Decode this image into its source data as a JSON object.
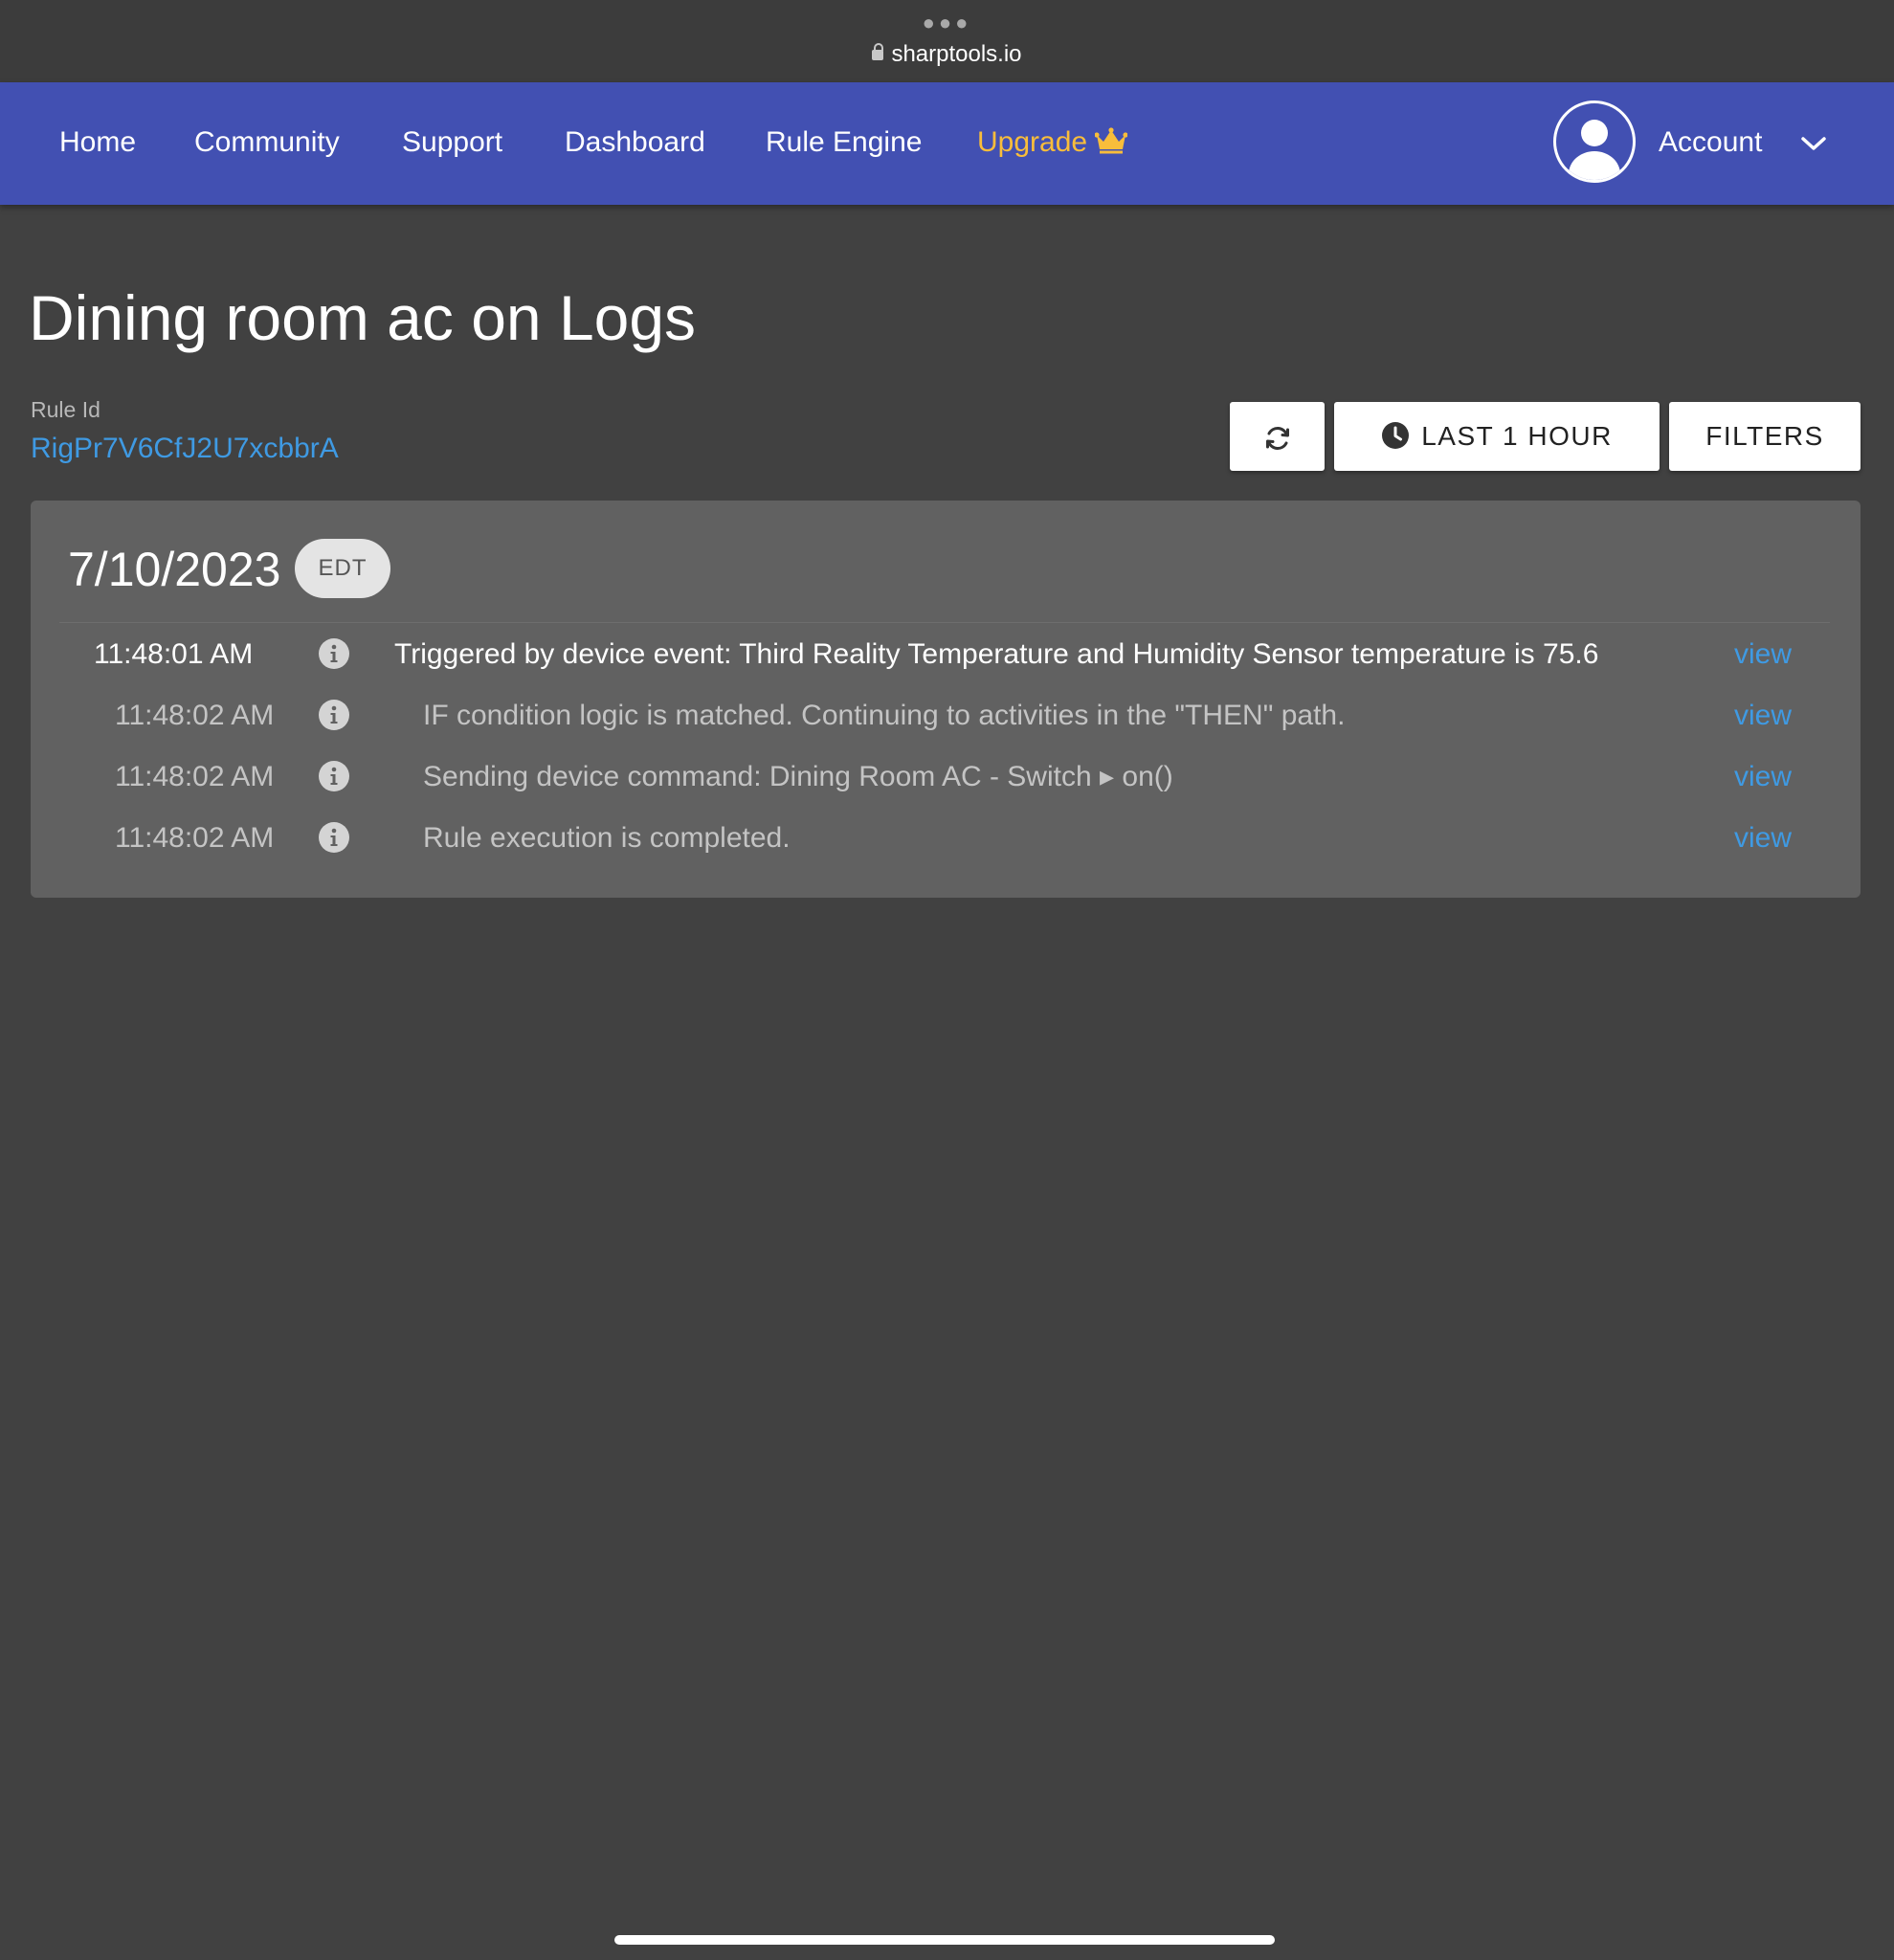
{
  "browser": {
    "url": "sharptools.io"
  },
  "nav": {
    "home": "Home",
    "community": "Community",
    "support": "Support",
    "dashboard": "Dashboard",
    "rule_engine": "Rule Engine",
    "upgrade": "Upgrade",
    "account": "Account",
    "accent_color": "#4250b2",
    "upgrade_color": "#f8bd3b"
  },
  "page": {
    "title": "Dining room ac on Logs",
    "rule_id_label": "Rule Id",
    "rule_id": "RigPr7V6CfJ2U7xcbbrA"
  },
  "toolbar": {
    "refresh_icon": "refresh-icon",
    "range_label": "LAST 1 HOUR",
    "filters_label": "FILTERS"
  },
  "logs": {
    "date": "7/10/2023",
    "timezone": "EDT",
    "entries": [
      {
        "time": "11:48:01 AM",
        "message": "Triggered by device event: Third Reality Temperature and Humidity Sensor temperature is 75.6",
        "action": "view"
      },
      {
        "time": "11:48:02 AM",
        "message": "IF condition logic is matched. Continuing to activities in the \"THEN\" path.",
        "action": "view"
      },
      {
        "time": "11:48:02 AM",
        "message": "Sending device command: Dining Room AC - Switch ▸ on()",
        "action": "view"
      },
      {
        "time": "11:48:02 AM",
        "message": "Rule execution is completed.",
        "action": "view"
      }
    ]
  }
}
